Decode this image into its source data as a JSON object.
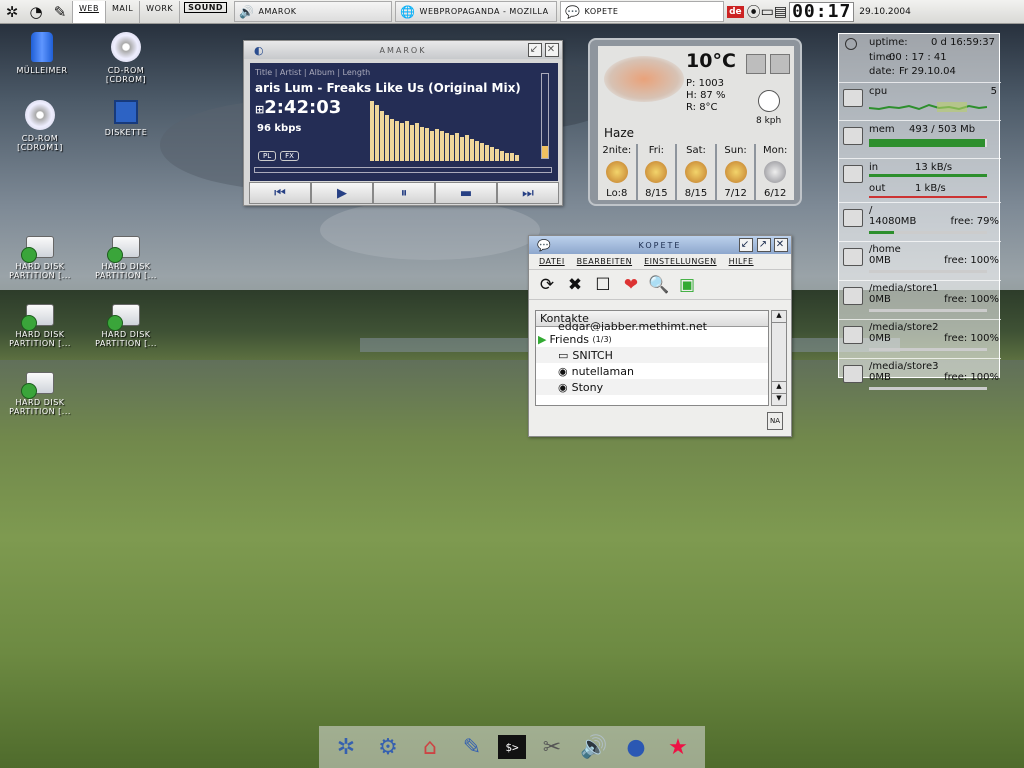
{
  "taskbar": {
    "kmenu_icon": "kde-logo-icon",
    "desktops": [
      "WEB",
      "MAIL",
      "WORK",
      "SOUND"
    ],
    "active_desktop": "WEB",
    "tasks": [
      {
        "label": "AMAROK",
        "icon": "amarok-icon"
      },
      {
        "label": "WEBPROPAGANDA - MOZILLA",
        "icon": "globe-icon"
      },
      {
        "label": "KOPETE",
        "icon": "chat-icon",
        "active": true
      }
    ],
    "keyboard_layout": "de",
    "clock": "00:17",
    "date": "29.10.2004"
  },
  "desktop_icons": [
    {
      "label": "MÜLLEIMER",
      "icon": "trash-icon"
    },
    {
      "label": "CD-ROM [CDROM]",
      "icon": "cdrom-icon"
    },
    {
      "label": "CD-ROM [CDROM1]",
      "icon": "cdrom-icon"
    },
    {
      "label": "DISKETTE",
      "icon": "floppy-icon"
    },
    {
      "label": "HARD DISK PARTITION [...",
      "icon": "hard-disk-icon"
    },
    {
      "label": "HARD DISK PARTITION [...",
      "icon": "hard-disk-icon"
    },
    {
      "label": "HARD DISK PARTITION [...",
      "icon": "hard-disk-icon"
    },
    {
      "label": "HARD DISK PARTITION [...",
      "icon": "hard-disk-icon"
    },
    {
      "label": "HARD DISK PARTITION [...",
      "icon": "hard-disk-icon"
    }
  ],
  "amarok": {
    "title": "AMAROK",
    "header_fields": "Title | Artist | Album | Length",
    "track": "aris Lum - Freaks Like Us (Original Mix)",
    "time": "2:42:03",
    "bitrate": "96 kbps",
    "pl_label": "PL",
    "fx_label": "FX",
    "controls": [
      "prev",
      "play",
      "pause",
      "stop",
      "next"
    ]
  },
  "weather": {
    "temperature": "10°C",
    "pressure": "P: 1003",
    "humidity": "H: 87 %",
    "realfeel": "R: 8°C",
    "wind": "8 kph",
    "condition": "Haze",
    "days": [
      {
        "name": "2nite:",
        "temps": "Lo:8"
      },
      {
        "name": "Fri:",
        "temps": "8/15"
      },
      {
        "name": "Sat:",
        "temps": "8/15"
      },
      {
        "name": "Sun:",
        "temps": "7/12"
      },
      {
        "name": "Mon:",
        "temps": "6/12"
      }
    ]
  },
  "sysmon": {
    "uptime_label": "uptime:",
    "uptime": "0 d 16:59:37",
    "time_label": "time:",
    "time": "00 : 17 : 41",
    "date_label": "date:",
    "date": "Fr 29.10.04",
    "cpu_label": "cpu",
    "cpu_value": "5",
    "mem_label": "mem",
    "mem_value": "493 / 503 Mb",
    "mem_fraction": 0.98,
    "net_in_label": "in",
    "net_in": "13 kB/s",
    "net_out_label": "out",
    "net_out": "1 kB/s",
    "disks": [
      {
        "mount": "/",
        "size": "14080MB",
        "free": "free: 79%",
        "used_fraction": 0.21
      },
      {
        "mount": "/home",
        "size": "0MB",
        "free": "free: 100%",
        "used_fraction": 0
      },
      {
        "mount": "/media/store1",
        "size": "0MB",
        "free": "free: 100%",
        "used_fraction": 0
      },
      {
        "mount": "/media/store2",
        "size": "0MB",
        "free": "free: 100%",
        "used_fraction": 0
      },
      {
        "mount": "/media/store3",
        "size": "0MB",
        "free": "free: 100%",
        "used_fraction": 0
      }
    ]
  },
  "kopete": {
    "title": "KOPETE",
    "menus": [
      "DATEI",
      "BEARBEITEN",
      "EINSTELLUNGEN",
      "HILFE"
    ],
    "column_header": "Kontakte",
    "contacts_top": "edgar@jabber.methimt.net",
    "group_name": "Friends",
    "group_count": "(1/3)",
    "contacts": [
      "SNITCH",
      "nutellaman",
      "Stony"
    ],
    "status_badge": "NA"
  },
  "dock": {
    "icons": [
      "kde-logo-icon",
      "konqueror-icon",
      "home-icon",
      "editor-icon",
      "terminal-icon",
      "settings-icon",
      "sound-icon",
      "globe-icon",
      "star-icon"
    ]
  }
}
